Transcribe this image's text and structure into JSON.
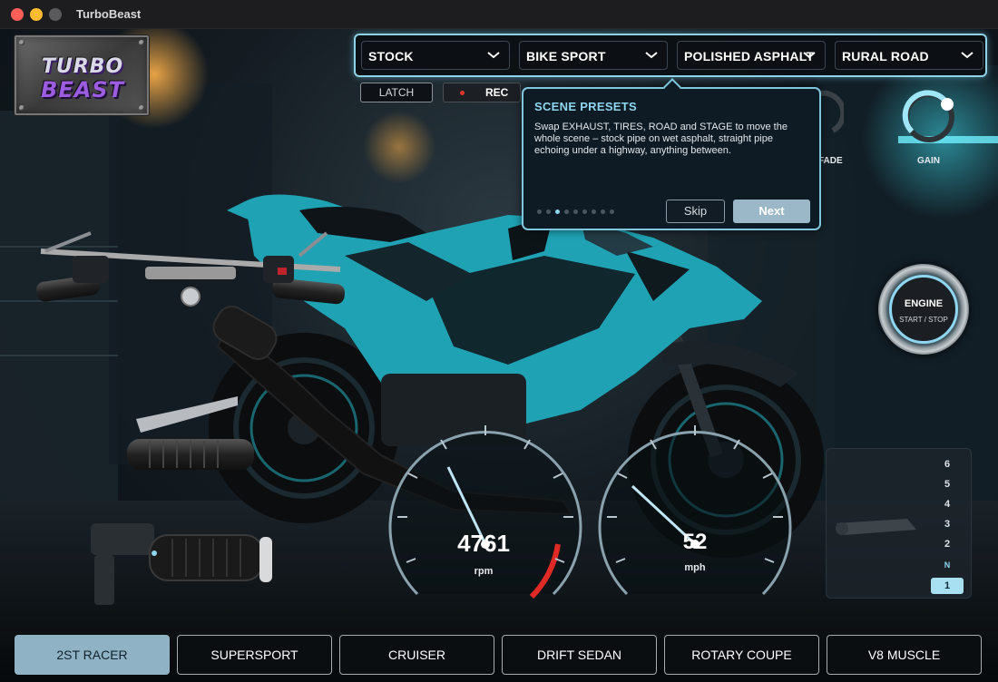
{
  "window": {
    "title": "TurboBeast"
  },
  "logo": {
    "line1": "TURBO",
    "line2": "BEAST"
  },
  "presets": {
    "exhaust": "STOCK",
    "tires": "BIKE SPORT",
    "road": "POLISHED ASPHALT",
    "stage": "RURAL ROAD"
  },
  "controls": {
    "latch_label": "LATCH",
    "rec_label": "REC"
  },
  "tooltip": {
    "title": "SCENE PRESETS",
    "body": "Swap EXHAUST, TIRES, ROAD and STAGE to move the whole scene – stock pipe on wet asphalt, straight pipe echoing under a highway, anything between.",
    "step_count": 9,
    "current_step": 3,
    "skip_label": "Skip",
    "next_label": "Next"
  },
  "knobs": {
    "fade_label": "FADE",
    "gain_label": "GAIN"
  },
  "engine": {
    "title": "ENGINE",
    "subtitle": "START / STOP"
  },
  "gauges": {
    "rpm_value": "4761",
    "rpm_unit": "rpm",
    "speed_value": "52",
    "speed_unit": "mph"
  },
  "gears": [
    "6",
    "5",
    "4",
    "3",
    "2",
    "N",
    "1"
  ],
  "active_gear": "1",
  "vehicles": [
    "2ST RACER",
    "SUPERSPORT",
    "CRUISER",
    "DRIFT SEDAN",
    "ROTARY COUPE",
    "V8 MUSCLE"
  ],
  "active_vehicle": "2ST RACER",
  "colors": {
    "accent": "#8fd6f0",
    "bike_teal": "#1fa3b4",
    "redline": "#e02a26",
    "active_tab": "#8fb2c4"
  }
}
